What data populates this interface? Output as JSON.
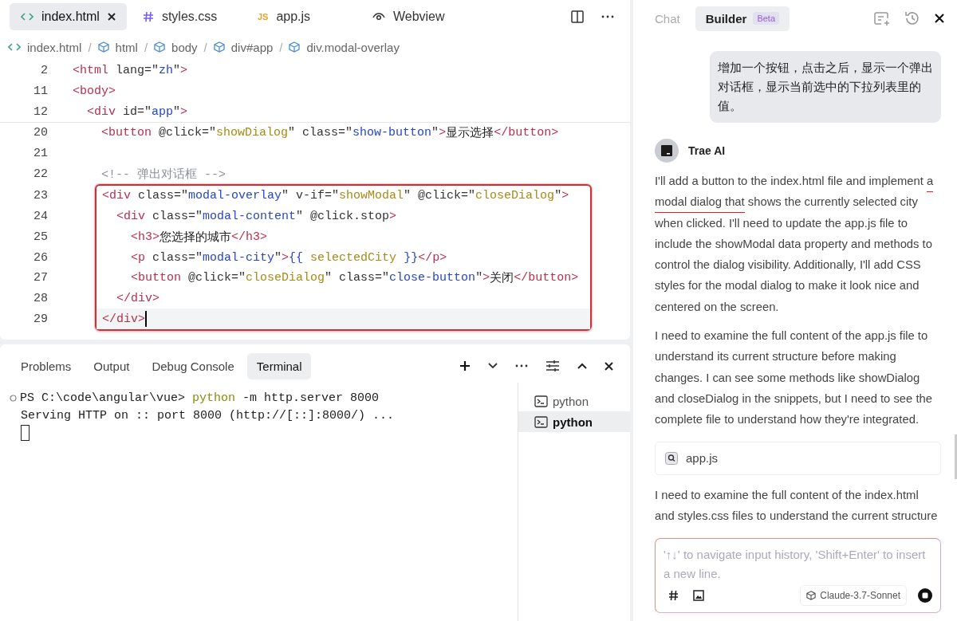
{
  "editor": {
    "tabs": [
      {
        "label": "index.html",
        "kind": "html",
        "selected": true,
        "closable": true
      },
      {
        "label": "styles.css",
        "kind": "css",
        "selected": false,
        "closable": false
      },
      {
        "label": "app.js",
        "kind": "js",
        "selected": false,
        "closable": false,
        "badge": "JS"
      },
      {
        "label": "Webview",
        "kind": "webview",
        "selected": false,
        "closable": false
      }
    ],
    "breadcrumb": [
      {
        "label": "index.html",
        "kind": "file"
      },
      {
        "sep": "/",
        "label": "html",
        "kind": "element"
      },
      {
        "sep": "/",
        "label": "body",
        "kind": "element"
      },
      {
        "sep": "/",
        "label": "div#app",
        "kind": "element"
      },
      {
        "sep": "/",
        "label": "div.modal-overlay",
        "kind": "element"
      }
    ],
    "sections": [
      {
        "kind": "sticky",
        "lines": [
          {
            "num": "2",
            "segs": [
              {
                "text": "<html",
                "kind": "tag"
              },
              {
                "text": " lang=\"",
                "kind": "attr"
              },
              {
                "text": "zh",
                "kind": "str"
              },
              {
                "text": "\"",
                "kind": "attr"
              },
              {
                "text": ">",
                "kind": "tag"
              }
            ]
          },
          {
            "num": "11",
            "segs": [
              {
                "text": "<body>",
                "kind": "tag"
              }
            ]
          },
          {
            "num": "12",
            "segs": [
              {
                "text": "  <div",
                "kind": "tag"
              },
              {
                "text": " id=\"",
                "kind": "attr"
              },
              {
                "text": "app",
                "kind": "str"
              },
              {
                "text": "\"",
                "kind": "attr"
              },
              {
                "text": ">",
                "kind": "tag"
              }
            ]
          }
        ]
      },
      {
        "kind": "plain",
        "lines": [
          {
            "num": "20",
            "segs": [
              {
                "text": "    <button",
                "kind": "tag"
              },
              {
                "text": " @click=\"",
                "kind": "attr"
              },
              {
                "text": "showDialog",
                "kind": "fn"
              },
              {
                "text": "\" class=\"",
                "kind": "attr"
              },
              {
                "text": "show-button",
                "kind": "str"
              },
              {
                "text": "\"",
                "kind": "attr"
              },
              {
                "text": ">",
                "kind": "tag"
              },
              {
                "text": "显示选择",
                "kind": "text"
              },
              {
                "text": "</button>",
                "kind": "tag"
              }
            ]
          },
          {
            "num": "21"
          },
          {
            "num": "22",
            "segs": [
              {
                "text": "    <!-- 弹出对话框 -->",
                "kind": "comment"
              }
            ]
          }
        ]
      },
      {
        "kind": "boxed",
        "lines": [
          {
            "num": "23",
            "segs": [
              {
                "text": "<div",
                "kind": "tag"
              },
              {
                "text": " class=\"",
                "kind": "attr"
              },
              {
                "text": "modal-overlay",
                "kind": "str"
              },
              {
                "text": "\" v-if=\"",
                "kind": "attr"
              },
              {
                "text": "showModal",
                "kind": "fn"
              },
              {
                "text": "\" @click=\"",
                "kind": "attr"
              },
              {
                "text": "closeDialog",
                "kind": "fn"
              },
              {
                "text": "\"",
                "kind": "attr"
              },
              {
                "text": ">",
                "kind": "tag"
              }
            ]
          },
          {
            "num": "24",
            "segs": [
              {
                "text": "  <div",
                "kind": "tag"
              },
              {
                "text": " class=\"",
                "kind": "attr"
              },
              {
                "text": "modal-content",
                "kind": "str"
              },
              {
                "text": "\" @click.stop",
                "kind": "attr"
              },
              {
                "text": ">",
                "kind": "tag"
              }
            ]
          },
          {
            "num": "25",
            "segs": [
              {
                "text": "    <h3>",
                "kind": "tag"
              },
              {
                "text": "您选择的城市",
                "kind": "text"
              },
              {
                "text": "</h3>",
                "kind": "tag"
              }
            ]
          },
          {
            "num": "26",
            "segs": [
              {
                "text": "    <p",
                "kind": "tag"
              },
              {
                "text": " class=\"",
                "kind": "attr"
              },
              {
                "text": "modal-city",
                "kind": "str"
              },
              {
                "text": "\"",
                "kind": "attr"
              },
              {
                "text": ">",
                "kind": "tag"
              },
              {
                "text": "{{",
                "kind": "str"
              },
              {
                "text": " selectedCity ",
                "kind": "fn"
              },
              {
                "text": "}}",
                "kind": "str"
              },
              {
                "text": "</p>",
                "kind": "tag"
              }
            ]
          },
          {
            "num": "27",
            "segs": [
              {
                "text": "    <button",
                "kind": "tag"
              },
              {
                "text": " @click=\"",
                "kind": "attr"
              },
              {
                "text": "closeDialog",
                "kind": "fn"
              },
              {
                "text": "\" class=\"",
                "kind": "attr"
              },
              {
                "text": "close-button",
                "kind": "str"
              },
              {
                "text": "\"",
                "kind": "attr"
              },
              {
                "text": ">",
                "kind": "tag"
              },
              {
                "text": "关闭",
                "kind": "text"
              },
              {
                "text": "</button>",
                "kind": "tag"
              }
            ]
          },
          {
            "num": "28",
            "segs": [
              {
                "text": "  </div>",
                "kind": "tag"
              }
            ]
          },
          {
            "num": "29",
            "current": true,
            "segs": [
              {
                "text": "</div>",
                "kind": "tag"
              }
            ]
          }
        ]
      }
    ]
  },
  "panel": {
    "tabs": [
      {
        "label": "Problems",
        "selected": false
      },
      {
        "label": "Output",
        "selected": false
      },
      {
        "label": "Debug Console",
        "selected": false
      },
      {
        "label": "Terminal",
        "selected": true
      }
    ],
    "terminal_lines": [
      {
        "kind": "prompt",
        "prompt": "PS C:\\code\\angular\\vue> ",
        "command": "python",
        "args": " -m http.server 8000"
      },
      {
        "kind": "output",
        "text": "Serving HTTP on :: port 8000 (http://[::]:8000/) ..."
      },
      {
        "kind": "cursor"
      }
    ],
    "terminals": [
      {
        "label": "python",
        "selected": false
      },
      {
        "label": "python",
        "selected": true
      }
    ]
  },
  "chat": {
    "tabs": [
      {
        "label": "Chat",
        "selected": false
      },
      {
        "label": "Builder",
        "selected": true,
        "badge": "Beta"
      }
    ],
    "user_message": "增加一个按钮，点击之后，显示一个弹出对话框，显示当前选中的下拉列表里的值。",
    "assistant": "Trae AI",
    "messages": [
      {
        "kind": "paragraph",
        "parts": [
          {
            "text": "I'll add a button to the index.html file and implement ",
            "underlined": false
          },
          {
            "text": "a modal dialog that",
            "underlined": true
          },
          {
            "text": " shows the currently selected city when clicked. I'll need to update the app.js file to include the showModal data property and methods to control the dialog visibility. Additionally, I'll add CSS styles for the modal dialog to make it look nice and centered on the screen.",
            "underlined": false
          }
        ]
      },
      {
        "kind": "paragraph",
        "parts": [
          {
            "text": "I need to examine the full content of the app.js file to understand its current structure before making changes. I can see some methods like showDialog and closeDialog in the snippets, but I need to see the complete file to understand how they're integrated.",
            "underlined": false
          }
        ]
      },
      {
        "kind": "file",
        "label": "app.js"
      },
      {
        "kind": "paragraph",
        "parts": [
          {
            "text": "I need to examine the full content of the index.html and styles.css files to understand the current structure",
            "underlined": false
          }
        ]
      }
    ],
    "input": {
      "placeholder": "'↑↓' to navigate input history, 'Shift+Enter' to insert a new line.",
      "model": "Claude-3.7-Sonnet"
    }
  }
}
